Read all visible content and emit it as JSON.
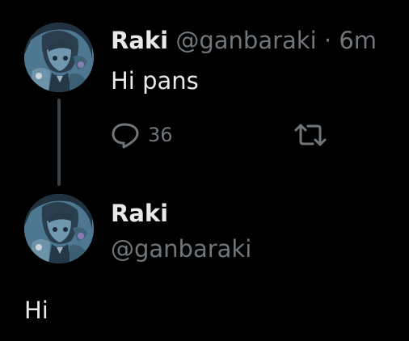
{
  "parent_tweet": {
    "display_name": "Raki",
    "handle": "@ganbaraki",
    "separator": "·",
    "time": "6m",
    "text": "Hi pans",
    "reply_count": "36",
    "avatar_icon": "anime-avatar-icon"
  },
  "reply_tweet": {
    "display_name": "Raki",
    "handle": "@ganbaraki",
    "text": "Hi",
    "avatar_icon": "anime-avatar-icon"
  },
  "icons": {
    "reply": "reply-icon",
    "retweet": "retweet-icon"
  },
  "colors": {
    "background": "#000000",
    "primary_text": "#e7e9ea",
    "secondary_text": "#71767b",
    "thread_line": "#3c4349",
    "avatar_bg": "#4a6f86"
  }
}
